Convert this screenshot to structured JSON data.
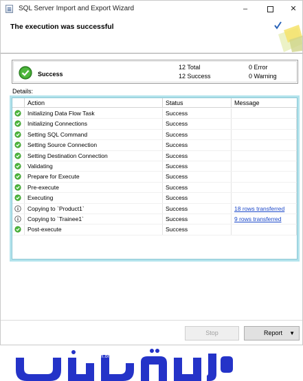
{
  "window": {
    "title": "SQL Server Import and Export Wizard",
    "header_title": "The execution was successful"
  },
  "summary": {
    "status": "Success",
    "total_line": "12 Total",
    "success_line": "12 Success",
    "error_line": "0  Error",
    "warning_line": "0  Warning"
  },
  "details_label": "Details:",
  "table": {
    "columns": [
      "Action",
      "Status",
      "Message"
    ],
    "rows": [
      {
        "icon": "success",
        "action": "Initializing Data Flow Task",
        "status": "Success",
        "message": ""
      },
      {
        "icon": "success",
        "action": "Initializing Connections",
        "status": "Success",
        "message": ""
      },
      {
        "icon": "success",
        "action": "Setting SQL Command",
        "status": "Success",
        "message": ""
      },
      {
        "icon": "success",
        "action": "Setting Source Connection",
        "status": "Success",
        "message": ""
      },
      {
        "icon": "success",
        "action": "Setting Destination Connection",
        "status": "Success",
        "message": ""
      },
      {
        "icon": "success",
        "action": "Validating",
        "status": "Success",
        "message": ""
      },
      {
        "icon": "success",
        "action": "Prepare for Execute",
        "status": "Success",
        "message": ""
      },
      {
        "icon": "success",
        "action": "Pre-execute",
        "status": "Success",
        "message": ""
      },
      {
        "icon": "success",
        "action": "Executing",
        "status": "Success",
        "message": ""
      },
      {
        "icon": "info",
        "action": "Copying to `Product1`",
        "status": "Success",
        "message": "18 rows transferred"
      },
      {
        "icon": "info",
        "action": "Copying to `Trainee1`",
        "status": "Success",
        "message": "9 rows transferred"
      },
      {
        "icon": "success",
        "action": "Post-execute",
        "status": "Success",
        "message": ""
      }
    ]
  },
  "buttons": {
    "stop": "Stop",
    "report": "Report"
  },
  "colors": {
    "success_green": "#3a9a2c",
    "link_blue": "#1b48c9",
    "highlight_border": "#b3e3ec",
    "logo_blue": "#2433c8"
  },
  "logo": {
    "url_text": "www.BarnameNevisan.org"
  }
}
